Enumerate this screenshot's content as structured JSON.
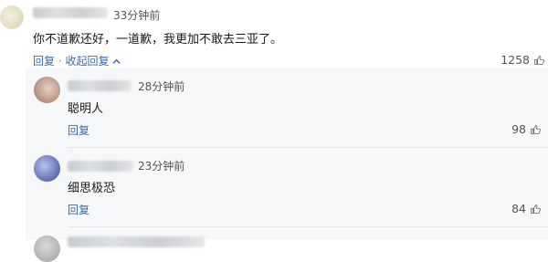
{
  "main_comment": {
    "time": "33分钟前",
    "text": "你不道歉还好，一道歉，我更加不敢去三亚了。",
    "reply_label": "回复",
    "separator": "·",
    "collapse_label": "收起回复",
    "like_count": "1258"
  },
  "replies": [
    {
      "time": "28分钟前",
      "text": "聪明人",
      "reply_label": "回复",
      "like_count": "98"
    },
    {
      "time": "23分钟前",
      "text": "细思极恐",
      "reply_label": "回复",
      "like_count": "84"
    }
  ],
  "colors": {
    "link": "#3b6aa8",
    "panel_bg": "#f6f7f9",
    "divider": "#e2e4e8"
  },
  "icons": [
    "thumbs-up-icon",
    "chevron-up-icon"
  ]
}
